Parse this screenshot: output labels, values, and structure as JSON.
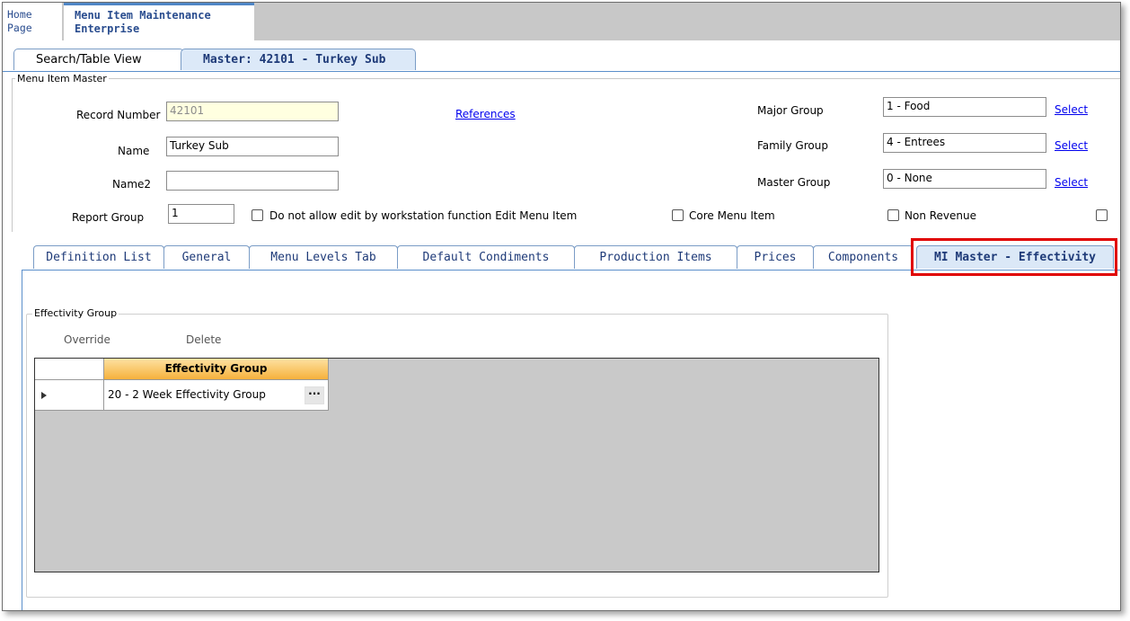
{
  "header": {
    "home_line1": "Home",
    "home_line2": "Page",
    "app_line1": "Menu Item Maintenance",
    "app_line2": "Enterprise"
  },
  "subtabs": {
    "search": "Search/Table View",
    "master": "Master: 42101 - Turkey Sub"
  },
  "master": {
    "legend": "Menu Item Master",
    "record_number_label": "Record Number",
    "record_number": "42101",
    "references_link": "References",
    "name_label": "Name",
    "name": "Turkey Sub",
    "name2_label": "Name2",
    "name2": "",
    "report_group_label": "Report Group",
    "report_group": "1",
    "no_edit_label": "Do not allow edit by workstation function Edit Menu Item",
    "core_item_label": "Core Menu Item",
    "non_revenue_label": "Non Revenue",
    "major_group_label": "Major Group",
    "major_group": "1 - Food",
    "family_group_label": "Family Group",
    "family_group": "4 - Entrees",
    "master_group_label": "Master Group",
    "master_group": "0 - None",
    "select_label": "Select"
  },
  "inner_tabs": [
    "Definition List",
    "General",
    "Menu Levels Tab",
    "Default Condiments",
    "Production Items",
    "Prices",
    "Components",
    "MI Master - Effectivity"
  ],
  "effectivity": {
    "legend": "Effectivity Group",
    "override_label": "Override",
    "delete_label": "Delete",
    "column_header": "Effectivity Group",
    "rows": [
      {
        "value": "20 - 2 Week Effectivity Group",
        "button": "···"
      }
    ]
  },
  "colors": {
    "tab_border": "#7a9cc6",
    "highlight": "#e00000",
    "grid_header": "#f6b13c"
  }
}
